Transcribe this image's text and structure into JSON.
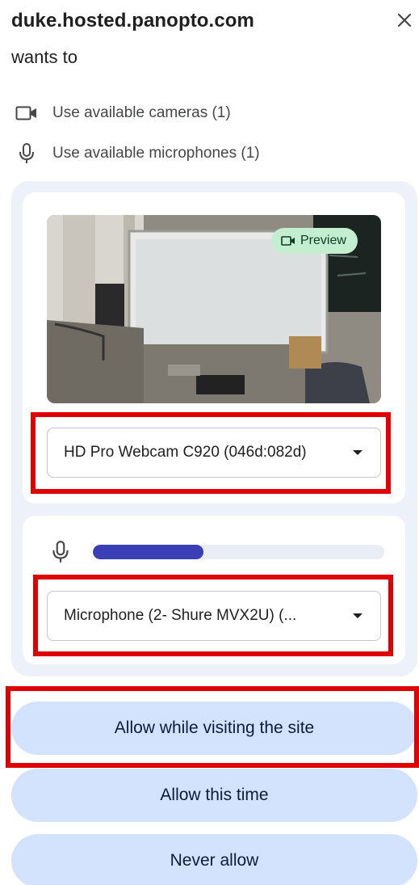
{
  "header": {
    "site": "duke.hosted.panopto.com",
    "subtitle": "wants to",
    "close_icon": "close-icon"
  },
  "permissions": {
    "camera": {
      "label": "Use available cameras (1)",
      "icon": "videocam-icon"
    },
    "microphone": {
      "label": "Use available microphones (1)",
      "icon": "mic-icon"
    }
  },
  "camera_panel": {
    "preview_label": "Preview",
    "selected_camera": "HD Pro Webcam C920 (046d:082d)"
  },
  "microphone_panel": {
    "level_fraction": 0.38,
    "selected_microphone": "Microphone (2- Shure MVX2U) (..."
  },
  "actions": {
    "allow_visit": "Allow while visiting the site",
    "allow_once": "Allow this time",
    "never": "Never allow"
  },
  "colors": {
    "panel_bg": "#edf2fa",
    "button_bg": "#d3e3fd",
    "preview_badge_bg": "#c4eed0",
    "level_fill": "#3b3fb5",
    "highlight": "#e00000"
  }
}
